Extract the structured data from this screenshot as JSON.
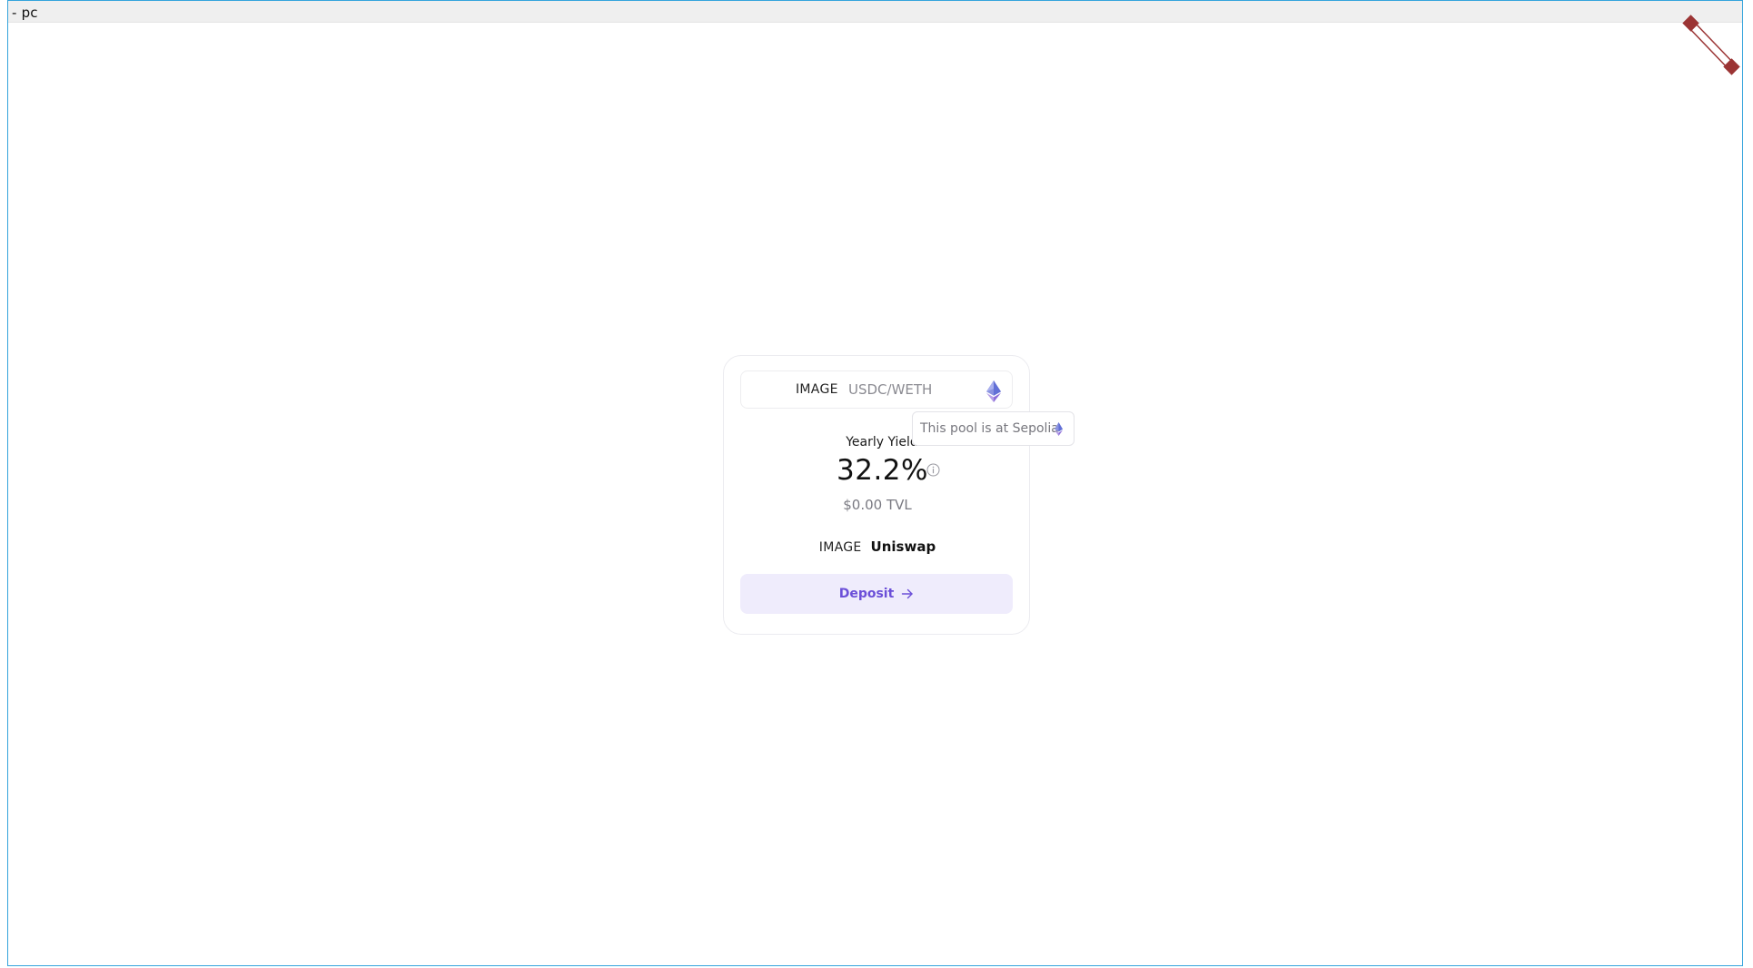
{
  "window": {
    "title": "- pc"
  },
  "pool_card": {
    "pair_image_placeholder": "IMAGE",
    "pair_name": "USDC/WETH",
    "network_icon": "ethereum-icon",
    "yield_label": "Yearly Yield",
    "yield_value": "32.2%",
    "info_icon": "info-icon",
    "tvl": "$0.00 TVL",
    "protocol_image_placeholder": "IMAGE",
    "protocol_name": "Uniswap",
    "deposit_label": "Deposit",
    "deposit_icon": "arrow-right-icon"
  },
  "tooltip": {
    "text": "This pool is at Sepolia",
    "icon": "ethereum-icon"
  },
  "colors": {
    "accent": "#6b4fd8",
    "button_bg": "#efecfc",
    "frame_border": "#35a4dc",
    "corner_decor": "#9b3434"
  }
}
